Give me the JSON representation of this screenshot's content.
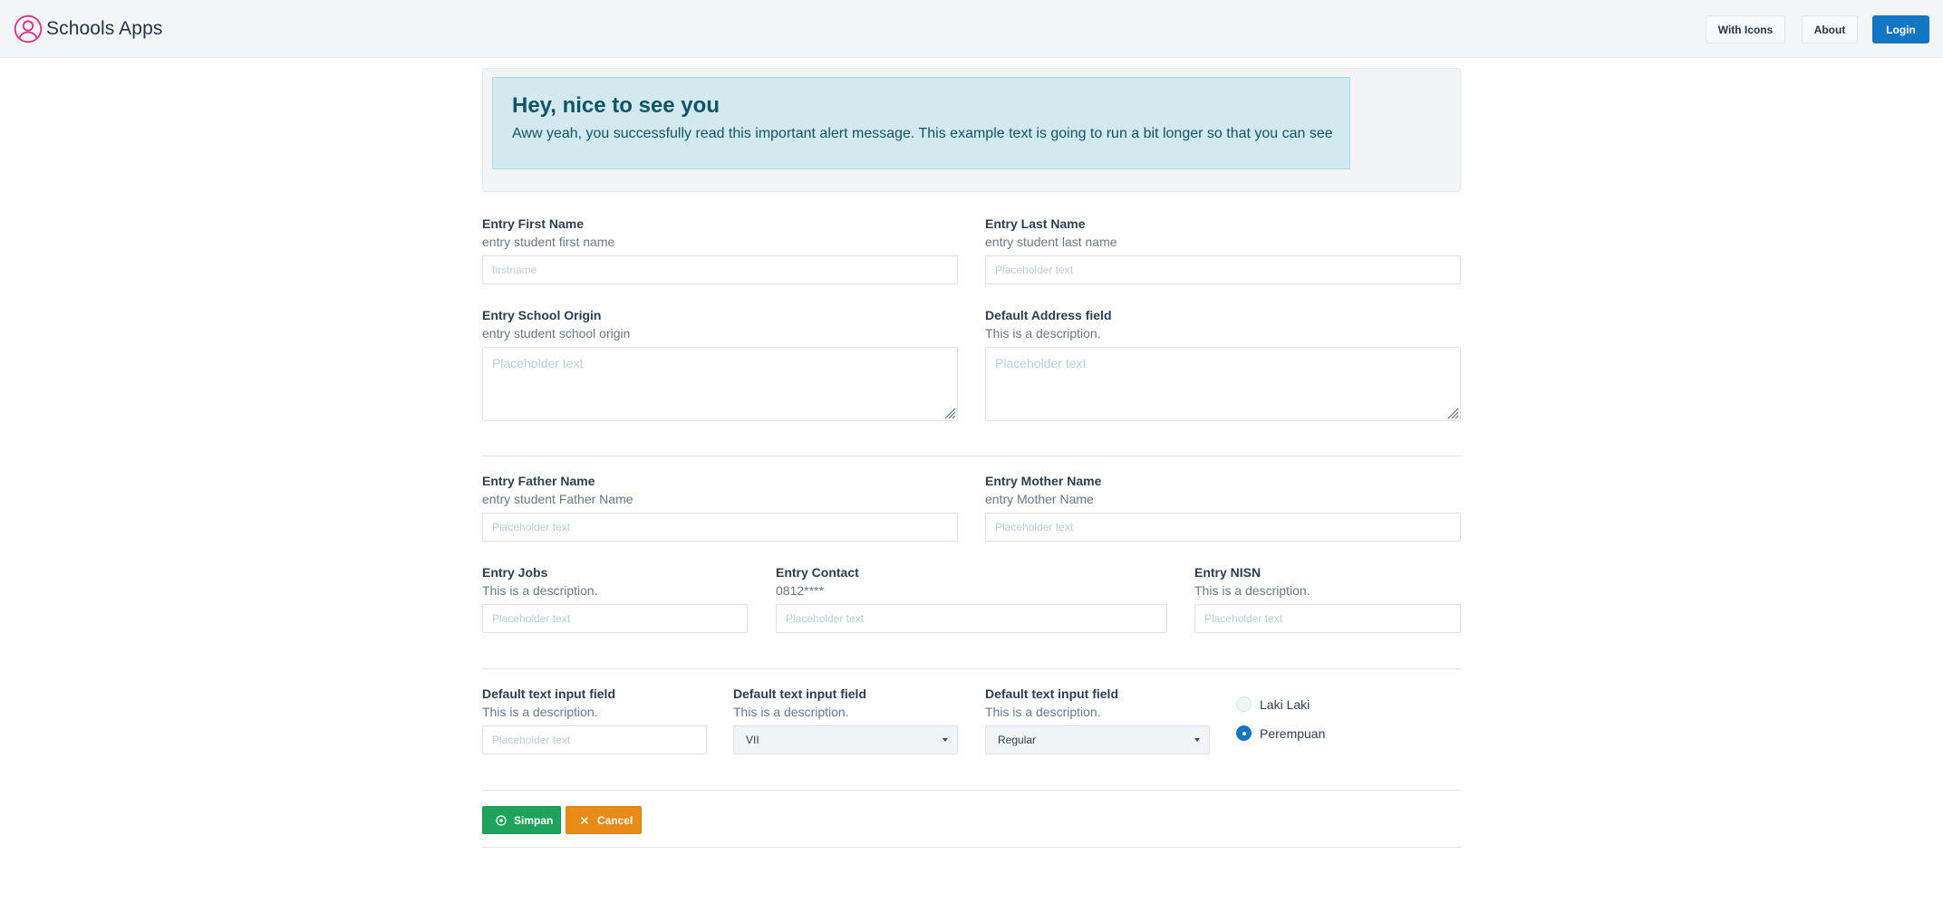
{
  "header": {
    "brand": "Schools Apps",
    "nav": {
      "with_icons": "With Icons",
      "about": "About",
      "login": "Login"
    }
  },
  "alert": {
    "title": "Hey, nice to see you",
    "text": "Aww yeah, you successfully read this important alert message. This example text is going to run a bit longer so that you can see"
  },
  "form": {
    "first_name": {
      "label": "Entry First Name",
      "desc": "entry student first name",
      "placeholder": "firstname",
      "value": ""
    },
    "last_name": {
      "label": "Entry Last Name",
      "desc": "entry student last name",
      "placeholder": "Placeholder text",
      "value": ""
    },
    "school_origin": {
      "label": "Entry School Origin",
      "desc": "entry student school origin",
      "placeholder": "Placeholder text",
      "value": ""
    },
    "address": {
      "label": "Default Address field",
      "desc": "This is a description.",
      "placeholder": "Placeholder text",
      "value": ""
    },
    "father_name": {
      "label": "Entry Father Name",
      "desc": "entry student Father Name",
      "placeholder": "Placeholder text",
      "value": ""
    },
    "mother_name": {
      "label": "Entry Mother Name",
      "desc": "entry Mother Name",
      "placeholder": "Placeholder text",
      "value": ""
    },
    "jobs": {
      "label": "Entry Jobs",
      "desc": "This is a description.",
      "placeholder": "Placeholder text",
      "value": ""
    },
    "contact": {
      "label": "Entry Contact",
      "desc": "0812****",
      "placeholder": "Placeholder text",
      "value": ""
    },
    "nisn": {
      "label": "Entry NISN",
      "desc": "This is a description.",
      "placeholder": "Placeholder text",
      "value": ""
    },
    "text_field": {
      "label": "Default text input field",
      "desc": "This is a description.",
      "placeholder": "Placeholder text",
      "value": ""
    },
    "class_select": {
      "label": "Default text input field",
      "desc": "This is a description.",
      "selected": "VII"
    },
    "program_select": {
      "label": "Default text input field",
      "desc": "This is a description.",
      "selected": "Regular"
    },
    "gender": {
      "options": [
        {
          "label": "Laki Laki",
          "checked": false
        },
        {
          "label": "Perempuan",
          "checked": true
        }
      ]
    }
  },
  "actions": {
    "save": "Simpan",
    "cancel": "Cancel"
  },
  "colors": {
    "primary": "#1376c5",
    "success": "#1fa35c",
    "warning": "#e88a17",
    "alert_bg": "#d1e9ef",
    "brand_icon": "#d6318a"
  },
  "icons": {
    "brand": "user-circle-icon",
    "save": "plus-circle-icon",
    "cancel": "close-icon"
  }
}
